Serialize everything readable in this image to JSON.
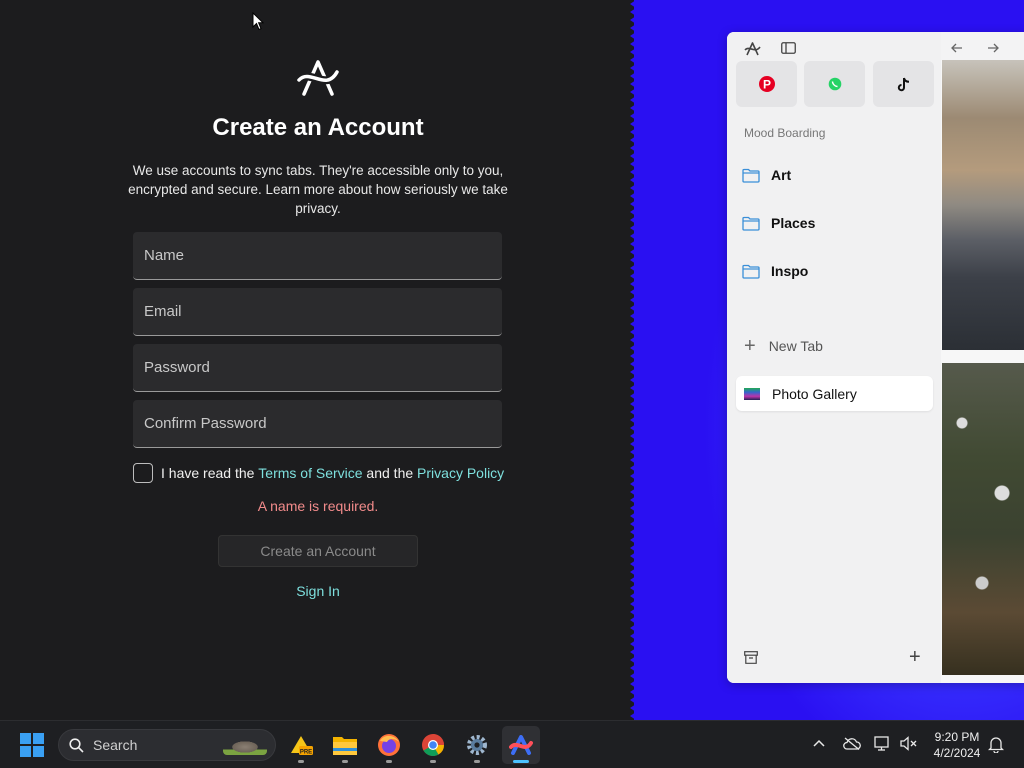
{
  "signup": {
    "title": "Create an Account",
    "description": "We use accounts to sync tabs. They're accessible only to you, encrypted and secure. Learn more about how seriously we take privacy.",
    "fields": {
      "name_placeholder": "Name",
      "email_placeholder": "Email",
      "password_placeholder": "Password",
      "confirm_placeholder": "Confirm Password"
    },
    "agree_prefix": "I have read the ",
    "terms_link": "Terms of Service",
    "agree_middle": " and the ",
    "privacy_link": "Privacy Policy",
    "error": "A name is required.",
    "create_button": "Create an Account",
    "sign_in_link": "Sign In"
  },
  "arc_sidebar": {
    "favorites": [
      "pinterest-icon",
      "whatsapp-icon",
      "tiktok-icon"
    ],
    "space_label": "Mood Boarding",
    "folders": [
      {
        "label": "Art"
      },
      {
        "label": "Places"
      },
      {
        "label": "Inspo"
      }
    ],
    "new_tab": "New Tab",
    "open_tab": "Photo Gallery"
  },
  "taskbar": {
    "search_label": "Search",
    "apps": [
      "adobe-premiere-icon",
      "file-explorer-icon",
      "firefox-icon",
      "chrome-icon",
      "settings-icon",
      "arc-browser-icon"
    ],
    "time": "9:20 PM",
    "date": "4/2/2024"
  },
  "colors": {
    "accent_link": "#7ee0de",
    "error": "#f28b8b",
    "background_dark": "#1c1c1e",
    "desktop_blue": "#2a10f2"
  }
}
